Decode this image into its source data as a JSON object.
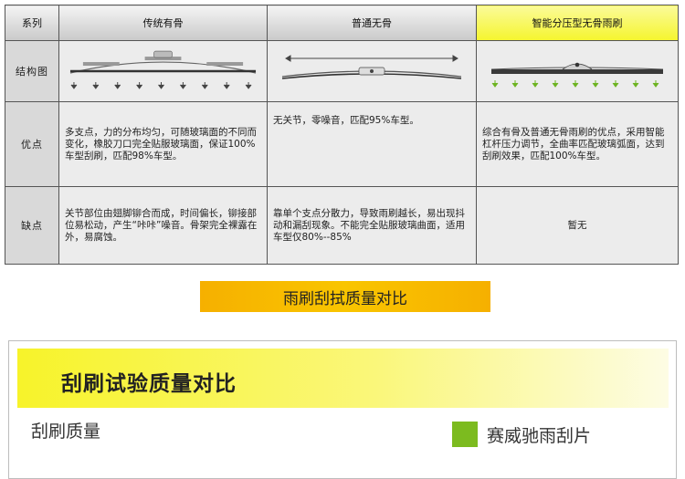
{
  "table": {
    "headers": [
      "系列",
      "传统有骨",
      "普通无骨",
      "智能分压型无骨雨刷"
    ],
    "rows": [
      {
        "label": "结构图",
        "cells": [
          "",
          "",
          ""
        ]
      },
      {
        "label": "优点",
        "cells": [
          "多支点，力的分布均匀，可随玻璃面的不同而变化，橡胶刀口完全贴服玻璃面，保证100%车型刮刷，匹配98%车型。",
          "无关节，零噪音，匹配95%车型。",
          "综合有骨及普通无骨雨刷的优点，采用智能杠杆压力调节，全曲率匹配玻璃弧面，达到刮刷效果，匹配100%车型。"
        ]
      },
      {
        "label": "缺点",
        "cells": [
          "关节部位由翅脚铆合而成，时间偏长，铆接部位易松动，产生“咔咔”噪音。骨架完全裸露在外，易腐蚀。",
          "靠单个支点分散力，导致雨刷越长，易出现抖动和漏刮现象。不能完全贴服玻璃曲面，适用车型仅80%--85%",
          "暂无"
        ]
      }
    ]
  },
  "banner": {
    "text": "雨刷刮拭质量对比"
  },
  "panel": {
    "title": "刮刷试验质量对比",
    "subtitle": "刮刷质量",
    "legend": {
      "label": "赛威驰雨刮片",
      "color": "#7cbb1f"
    }
  },
  "colors": {
    "highlight_header": "#f5f52e",
    "banner": "#f9c500",
    "arrow_gray": "#444444",
    "arrow_green": "#6db320"
  }
}
